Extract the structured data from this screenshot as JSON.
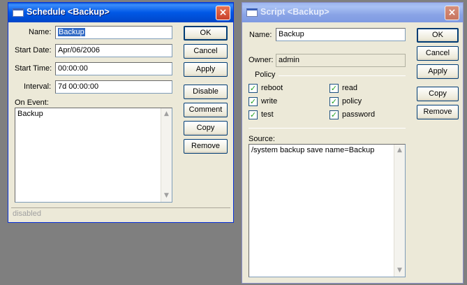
{
  "schedule": {
    "title": "Schedule <Backup>",
    "close_symbol": "×",
    "name_label": "Name:",
    "name_value": "Backup",
    "start_date_label": "Start Date:",
    "start_date_value": "Apr/06/2006",
    "start_time_label": "Start Time:",
    "start_time_value": "00:00:00",
    "interval_label": "Interval:",
    "interval_value": "7d 00:00:00",
    "on_event_label": "On Event:",
    "on_event_value": "Backup",
    "buttons": {
      "ok": "OK",
      "cancel": "Cancel",
      "apply": "Apply",
      "disable": "Disable",
      "comment": "Comment",
      "copy": "Copy",
      "remove": "Remove"
    },
    "status": "disabled"
  },
  "script": {
    "title": "Script <Backup>",
    "close_symbol": "×",
    "name_label": "Name:",
    "name_value": "Backup",
    "owner_label": "Owner:",
    "owner_value": "admin",
    "policy_label": "Policy",
    "policies": {
      "reboot": {
        "label": "reboot",
        "checked": true
      },
      "read": {
        "label": "read",
        "checked": true
      },
      "write": {
        "label": "write",
        "checked": true
      },
      "policy": {
        "label": "policy",
        "checked": true
      },
      "test": {
        "label": "test",
        "checked": true
      },
      "password": {
        "label": "password",
        "checked": true
      }
    },
    "check_mark": "✓",
    "source_label": "Source:",
    "source_value": "/system backup save name=Backup",
    "buttons": {
      "ok": "OK",
      "cancel": "Cancel",
      "apply": "Apply",
      "copy": "Copy",
      "remove": "Remove"
    }
  },
  "scroll_up": "▲",
  "scroll_down": "▼"
}
